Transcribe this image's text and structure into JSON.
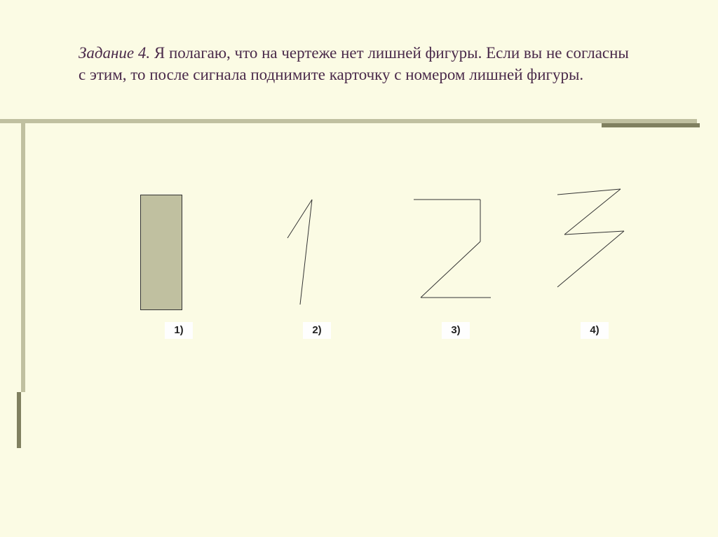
{
  "title": {
    "task_label": "Задание 4.",
    "body": " Я полагаю, что на чертеже нет лишней фигуры. Если вы не согласны с этим, то после сигнала поднимите карточку с номером лишней фигуры."
  },
  "options": {
    "opt1": "1)",
    "opt2": "2)",
    "opt3": "3)",
    "opt4": "4)"
  }
}
